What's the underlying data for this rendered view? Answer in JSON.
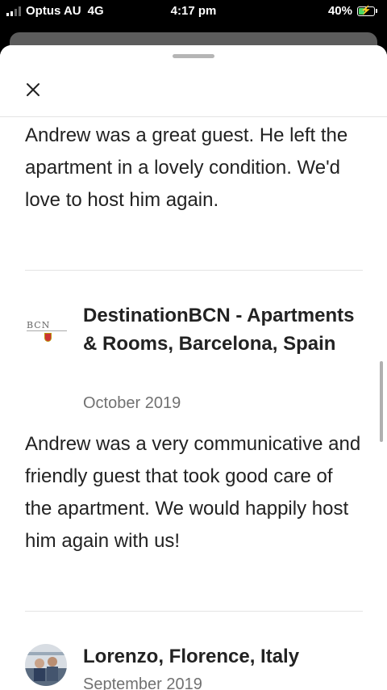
{
  "status_bar": {
    "carrier": "Optus AU",
    "network": "4G",
    "time": "4:17 pm",
    "battery": "40%",
    "battery_level": 0.4,
    "battery_color": "#4cd964"
  },
  "icons": {
    "close": "close-icon",
    "signal": "signal-icon",
    "battery": "battery-charging-icon"
  },
  "reviews": [
    {
      "text": "Andrew was a great guest. He left the apartment in a lovely condition. We'd love to host him again."
    },
    {
      "reviewer": "DestinationBCN - Apartments & Rooms, Barcelona, Spain",
      "date": "October 2019",
      "avatar_logo_text": "BCN",
      "text": "Andrew was a very communicative and friendly guest that took good care of the apartment. We would happily host him again with us!"
    },
    {
      "reviewer": "Lorenzo, Florence, Italy",
      "date": "September 2019"
    }
  ]
}
